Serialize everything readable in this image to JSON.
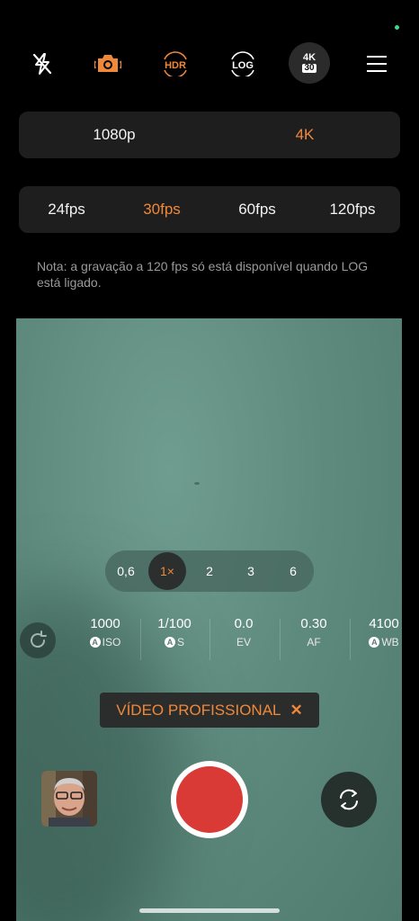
{
  "topbar": {
    "flash_icon": "flash-off-icon",
    "camera_mode_icon": "camera-icon",
    "hdr_label": "HDR",
    "log_label": "LOG",
    "res_badge_top": "4K",
    "res_badge_bottom": "30",
    "menu_icon": "hamburger-menu-icon"
  },
  "resolution": {
    "options": [
      "1080p",
      "4K"
    ],
    "selected": "4K"
  },
  "fps": {
    "options": [
      "24fps",
      "30fps",
      "60fps",
      "120fps"
    ],
    "selected": "30fps"
  },
  "note": "Nota: a gravação a 120 fps só está disponível quando LOG está ligado.",
  "zoom": {
    "levels": [
      "0,6",
      "1×",
      "2",
      "3",
      "6"
    ],
    "selected": "1×"
  },
  "pro_params": [
    {
      "value": "1000",
      "label": "ISO",
      "auto": true
    },
    {
      "value": "1/100",
      "label": "S",
      "auto": true
    },
    {
      "value": "0.0",
      "label": "EV",
      "auto": false
    },
    {
      "value": "0.30",
      "label": "AF",
      "auto": false
    },
    {
      "value": "4100",
      "label": "WB",
      "auto": true
    }
  ],
  "auto_badge": "A",
  "mode_chip": {
    "label": "VÍDEO PROFISSIONAL",
    "close": "✕"
  },
  "colors": {
    "accent": "#f0883a",
    "record": "#d93a36",
    "status_dot": "#3ddc84"
  }
}
